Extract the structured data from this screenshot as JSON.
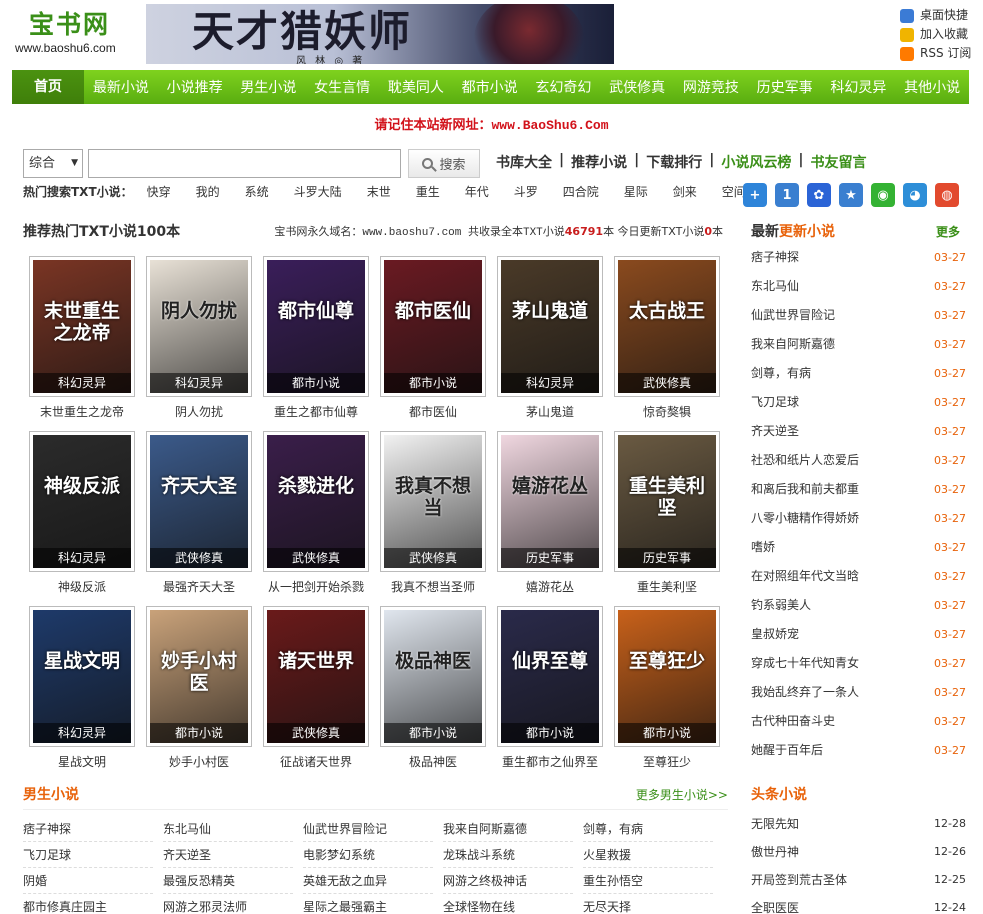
{
  "header": {
    "logo_title": "宝书网",
    "logo_url": "www.baoshu6.com",
    "banner_title": "天才猎妖师",
    "banner_sub": "风 林 ◎ 著",
    "quick_links": [
      {
        "label": "桌面快捷",
        "icon": "desktop-icon",
        "color": "#3b7bd5"
      },
      {
        "label": "加入收藏",
        "icon": "star-icon",
        "color": "#f0b400"
      },
      {
        "label": "RSS 订阅",
        "icon": "rss-icon",
        "color": "#ff7a00"
      }
    ]
  },
  "nav": {
    "home": "首页",
    "items": [
      "最新小说",
      "小说推荐",
      "男生小说",
      "女生言情",
      "耽美同人",
      "都市小说",
      "玄幻奇幻",
      "武侠修真",
      "网游竞技",
      "历史军事",
      "科幻灵异",
      "其他小说"
    ]
  },
  "notice": {
    "text": "请记住本站新网址：",
    "url": "www.BaoShu6.Com"
  },
  "search": {
    "select_value": "综合",
    "placeholder": "",
    "button": "搜索"
  },
  "toplinks": [
    "书库大全",
    "推荐小说",
    "下载排行",
    "小说风云榜",
    "书友留言"
  ],
  "hot": {
    "label": "热门搜索TXT小说：",
    "keywords": [
      "快穿",
      "我的",
      "系统",
      "斗罗大陆",
      "末世",
      "重生",
      "年代",
      "斗罗",
      "四合院",
      "星际",
      "剑来",
      "空间"
    ]
  },
  "share_icons": [
    {
      "name": "share-plus-icon",
      "glyph": "+",
      "color": "#2e84d9"
    },
    {
      "name": "share-1-icon",
      "glyph": "1",
      "color": "#3a7fd0"
    },
    {
      "name": "baidu-paw-icon",
      "glyph": "✿",
      "color": "#2b64d6"
    },
    {
      "name": "favorite-star-icon",
      "glyph": "★",
      "color": "#3a7fd0"
    },
    {
      "name": "wechat-icon",
      "glyph": "◉",
      "color": "#34b233"
    },
    {
      "name": "qq-icon",
      "glyph": "◕",
      "color": "#2d8ed8"
    },
    {
      "name": "weibo-icon",
      "glyph": "◍",
      "color": "#e24a2e"
    }
  ],
  "recommend": {
    "title": "推荐热门TXT小说100本",
    "domain_text": "宝书网永久域名：www.baoshu7.com 共收录全本TXT小说",
    "total": "46791",
    "unit1": "本 今日更新TXT小说",
    "today": "0",
    "unit2": "本"
  },
  "books": [
    {
      "name": "末世重生之龙帝",
      "category": "科幻灵异",
      "cover_text": "末世重生之龙帝",
      "bg": "#7a3524"
    },
    {
      "name": "阴人勿扰",
      "category": "科幻灵异",
      "cover_text": "阴人勿扰",
      "bg": "#e8e1d6"
    },
    {
      "name": "重生之都市仙尊",
      "category": "都市小说",
      "cover_text": "都市仙尊",
      "bg": "#3a1e5a"
    },
    {
      "name": "都市医仙",
      "category": "都市小说",
      "cover_text": "都市医仙",
      "bg": "#6a1a22"
    },
    {
      "name": "茅山鬼道",
      "category": "科幻灵异",
      "cover_text": "茅山鬼道",
      "bg": "#4a3a28"
    },
    {
      "name": "惊奇獒犋",
      "category": "武侠修真",
      "cover_text": "太古战王",
      "bg": "#8a4a1e"
    },
    {
      "name": "神级反派",
      "category": "科幻灵异",
      "cover_text": "神级反派",
      "bg": "#2b2b2b"
    },
    {
      "name": "最强齐天大圣",
      "category": "武侠修真",
      "cover_text": "齐天大圣",
      "bg": "#3b5a8a"
    },
    {
      "name": "从一把剑开始杀戮",
      "category": "武侠修真",
      "cover_text": "杀戮进化",
      "bg": "#3a1e4a"
    },
    {
      "name": "我真不想当圣师",
      "category": "武侠修真",
      "cover_text": "我真不想当",
      "bg": "#f2f2f2"
    },
    {
      "name": "嬉游花丛",
      "category": "历史军事",
      "cover_text": "嬉游花丛",
      "bg": "#f0d7e0"
    },
    {
      "name": "重生美利坚",
      "category": "历史军事",
      "cover_text": "重生美利坚",
      "bg": "#6a5a42"
    },
    {
      "name": "星战文明",
      "category": "科幻灵异",
      "cover_text": "星战文明",
      "bg": "#1e3a6a"
    },
    {
      "name": "妙手小村医",
      "category": "都市小说",
      "cover_text": "妙手小村医",
      "bg": "#c9a27a"
    },
    {
      "name": "征战诸天世界",
      "category": "武侠修真",
      "cover_text": "诸天世界",
      "bg": "#6a1a1a"
    },
    {
      "name": "极品神医",
      "category": "都市小说",
      "cover_text": "极品神医",
      "bg": "#e0e6ee"
    },
    {
      "name": "重生都市之仙界至",
      "category": "都市小说",
      "cover_text": "仙界至尊",
      "bg": "#2a2a4a"
    },
    {
      "name": "至尊狂少",
      "category": "都市小说",
      "cover_text": "至尊狂少",
      "bg": "#c8611a"
    }
  ],
  "latest": {
    "title_a": "最新",
    "title_b": "更新小说",
    "more": "更多",
    "items": [
      {
        "title": "痞子神探",
        "date": "03-27"
      },
      {
        "title": "东北马仙",
        "date": "03-27"
      },
      {
        "title": "仙武世界冒险记",
        "date": "03-27"
      },
      {
        "title": "我来自阿斯嘉德",
        "date": "03-27"
      },
      {
        "title": "剑尊，有病",
        "date": "03-27"
      },
      {
        "title": "飞刀足球",
        "date": "03-27"
      },
      {
        "title": "齐天逆圣",
        "date": "03-27"
      },
      {
        "title": "社恐和纸片人恋爱后",
        "date": "03-27"
      },
      {
        "title": "和离后我和前夫都重",
        "date": "03-27"
      },
      {
        "title": "八零小糖精作得娇娇",
        "date": "03-27"
      },
      {
        "title": "嗜娇",
        "date": "03-27"
      },
      {
        "title": "在对照组年代文当晗",
        "date": "03-27"
      },
      {
        "title": "钓系弱美人",
        "date": "03-27"
      },
      {
        "title": "皇叔娇宠",
        "date": "03-27"
      },
      {
        "title": "穿成七十年代知青女",
        "date": "03-27"
      },
      {
        "title": "我始乱终弃了一条人",
        "date": "03-27"
      },
      {
        "title": "古代种田奋斗史",
        "date": "03-27"
      },
      {
        "title": "她醒于百年后",
        "date": "03-27"
      }
    ]
  },
  "boys": {
    "title": "男生小说",
    "more": "更多男生小说>>",
    "items": [
      "痞子神探",
      "东北马仙",
      "仙武世界冒险记",
      "我来自阿斯嘉德",
      "剑尊，有病",
      "飞刀足球",
      "齐天逆圣",
      "电影梦幻系统",
      "龙珠战斗系统",
      "火星救援",
      "阴婚",
      "最强反恐精英",
      "英雄无敌之血异",
      "网游之终极神话",
      "重生孙悟空",
      "都市修真庄园主",
      "网游之邪灵法师",
      "星际之最强霸主",
      "全球怪物在线",
      "无尽天择"
    ]
  },
  "headlines": {
    "title": "头条小说",
    "items": [
      {
        "title": "无限先知",
        "date": "12-28"
      },
      {
        "title": "傲世丹神",
        "date": "12-26"
      },
      {
        "title": "开局签到荒古圣体",
        "date": "12-25"
      },
      {
        "title": "全职医医",
        "date": "12-24"
      }
    ]
  }
}
